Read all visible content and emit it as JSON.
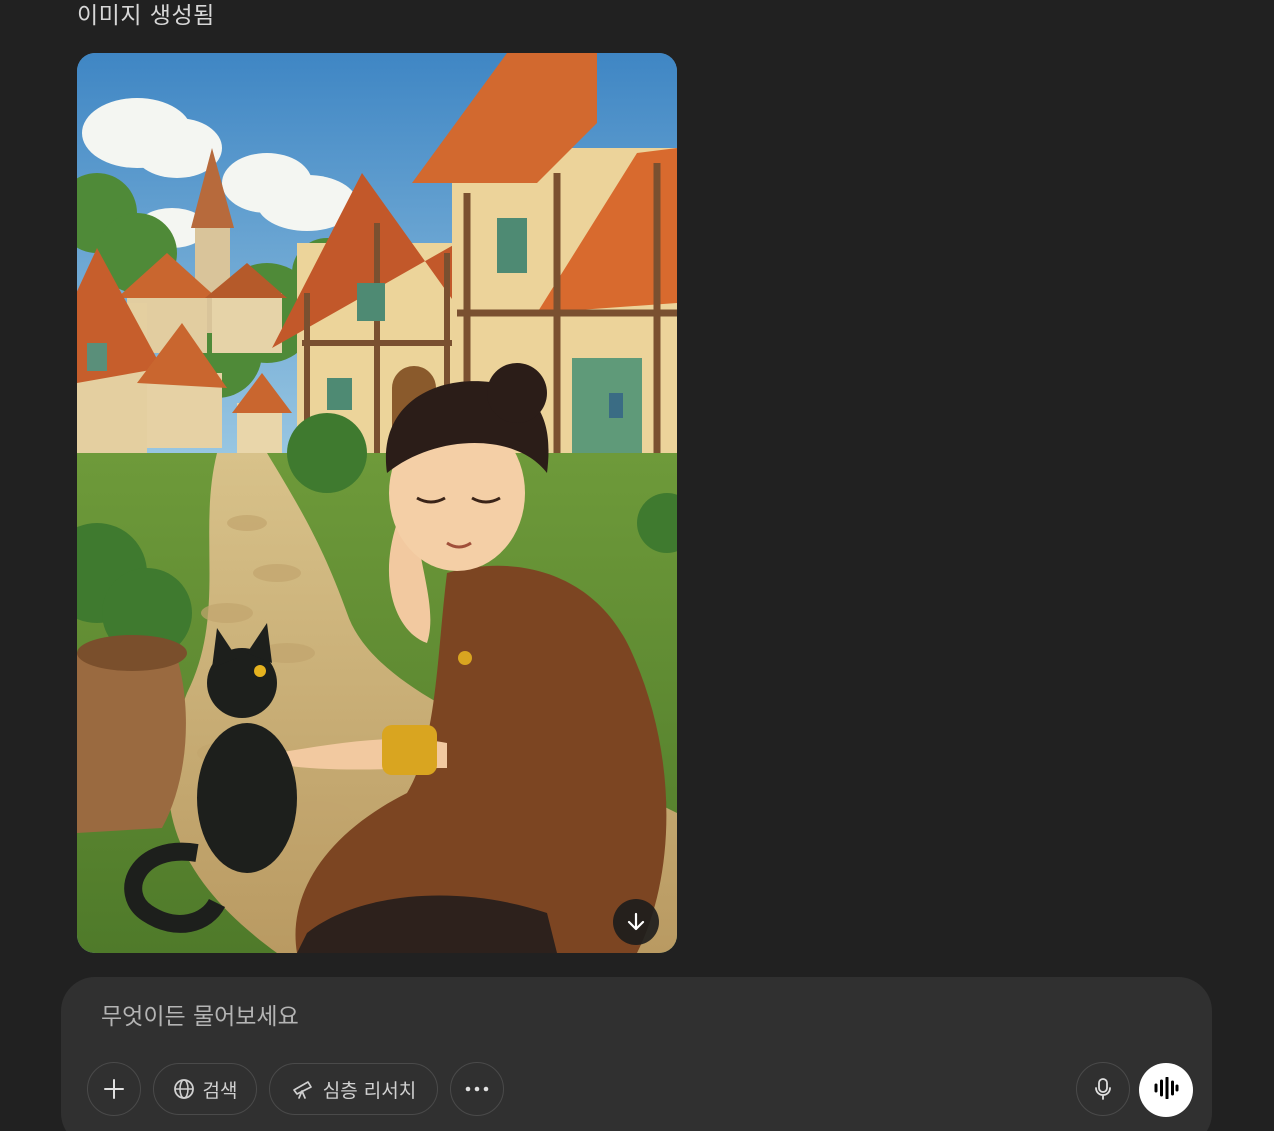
{
  "message": {
    "status_label": "이미지 생성됨"
  },
  "generated_image": {
    "description_icon": "illustration",
    "download_icon": "arrow-down-icon"
  },
  "composer": {
    "placeholder": "무엇이든 물어보세요",
    "value": "",
    "buttons": {
      "add_icon": "plus-icon",
      "search_label": "검색",
      "search_icon": "globe-icon",
      "research_label": "심층 리서치",
      "research_icon": "telescope-icon",
      "more_icon": "ellipsis-icon",
      "mic_icon": "microphone-icon",
      "voice_icon": "voice-waveform-icon"
    }
  },
  "colors": {
    "background": "#212121",
    "composer": "#303030",
    "pill_border": "#4a4a4a",
    "text": "#ececec",
    "placeholder": "#b4b4b4"
  }
}
